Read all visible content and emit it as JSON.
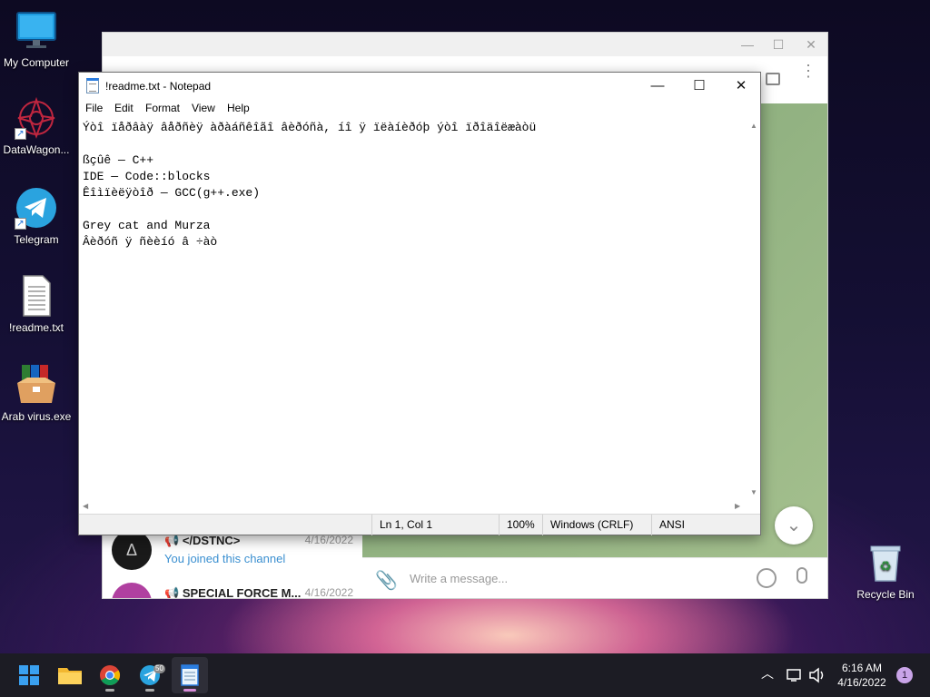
{
  "desktop": {
    "icons": [
      {
        "label": "My Computer",
        "icon": "monitor-icon"
      },
      {
        "label": "DataWagon...",
        "icon": "datawagon-icon"
      },
      {
        "label": "Telegram",
        "icon": "telegram-icon"
      },
      {
        "label": "!readme.txt",
        "icon": "text-file-icon"
      },
      {
        "label": "Arab virus.exe",
        "icon": "winrar-archive-icon"
      }
    ],
    "recycle_bin": "Recycle Bin"
  },
  "telegram": {
    "chats": [
      {
        "name": "</DSTNC>",
        "date": "4/16/2022",
        "message": "You joined this channel"
      },
      {
        "name": "SPECIAL FORCE M...",
        "date": "4/16/2022",
        "message": ""
      }
    ],
    "message_placeholder": "Write a message...",
    "colors": {
      "accent": "#3a8fd0",
      "chat_bg": "#8db082"
    }
  },
  "notepad": {
    "title": "!readme.txt - Notepad",
    "menu": [
      "File",
      "Edit",
      "Format",
      "View",
      "Help"
    ],
    "content": "Ýòî ïåðâàÿ âåðñèÿ àðàáñêîãî âèðóñà, íî ÿ ïëàíèðóþ ýòî ïðîäîëæàòü\n\nßçûê — C++\nIDE — Code::blocks\nÊîìïèëÿòîð — GCC(g++.exe)\n\nGrey cat and Murza\nÂèðóñ ÿ ñèèíó â ÷àò",
    "status": {
      "position": "Ln 1, Col 1",
      "zoom": "100%",
      "line_ending": "Windows (CRLF)",
      "encoding": "ANSI"
    },
    "window_buttons": {
      "minimize": "—",
      "maximize": "☐",
      "close": "✕"
    }
  },
  "taskbar": {
    "apps": [
      "start-icon",
      "file-explorer-icon",
      "chrome-icon",
      "telegram-icon",
      "notepad-icon"
    ],
    "telegram_badge": "50",
    "clock": {
      "time": "6:16 AM",
      "date": "4/16/2022"
    },
    "notifications": "1"
  }
}
